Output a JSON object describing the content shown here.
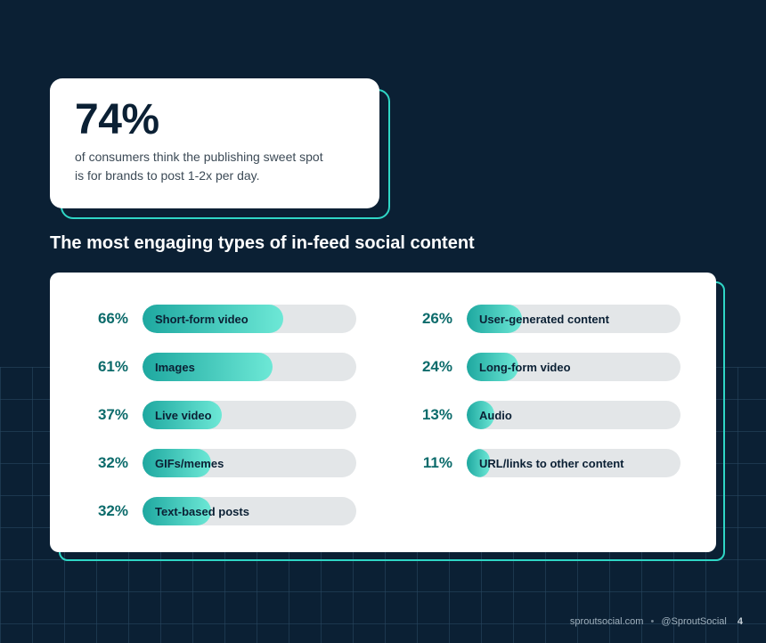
{
  "callout": {
    "stat": "74%",
    "description": "of consumers think the publishing sweet spot is for brands to post 1-2x per day."
  },
  "section_title": "The most engaging types of in-feed social content",
  "chart_data": {
    "type": "bar",
    "title": "The most engaging types of in-feed social content",
    "xlabel": "",
    "ylabel": "",
    "ylim": [
      0,
      100
    ],
    "categories": [
      "Short-form video",
      "Images",
      "Live video",
      "GIFs/memes",
      "Text-based posts",
      "User-generated content",
      "Long-form video",
      "Audio",
      "URL/links to other content"
    ],
    "values": [
      66,
      61,
      37,
      32,
      32,
      26,
      24,
      13,
      11
    ]
  },
  "bars_left": [
    {
      "pct": "66%",
      "value": 66,
      "label": "Short-form video"
    },
    {
      "pct": "61%",
      "value": 61,
      "label": "Images"
    },
    {
      "pct": "37%",
      "value": 37,
      "label": "Live video"
    },
    {
      "pct": "32%",
      "value": 32,
      "label": "GIFs/memes"
    },
    {
      "pct": "32%",
      "value": 32,
      "label": "Text-based posts"
    }
  ],
  "bars_right": [
    {
      "pct": "26%",
      "value": 26,
      "label": "User-generated content"
    },
    {
      "pct": "24%",
      "value": 24,
      "label": "Long-form video"
    },
    {
      "pct": "13%",
      "value": 13,
      "label": "Audio"
    },
    {
      "pct": "11%",
      "value": 11,
      "label": "URL/links to other content"
    }
  ],
  "footer": {
    "site": "sproutsocial.com",
    "handle": "@SproutSocial",
    "page": "4"
  }
}
